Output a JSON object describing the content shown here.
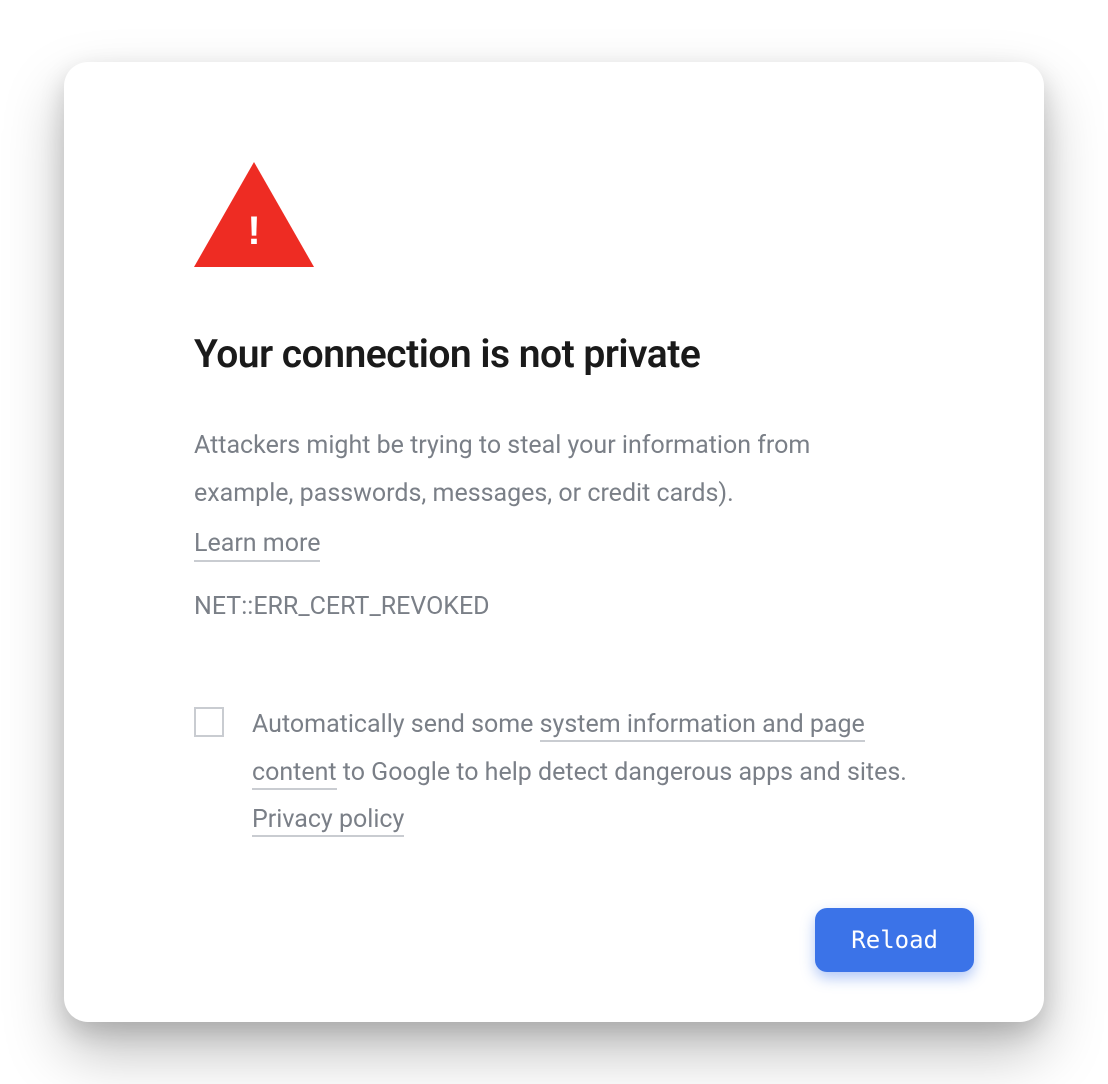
{
  "warning": {
    "title": "Your connection is not private",
    "body": "Attackers might be trying to steal your information from example, passwords, messages, or credit cards).",
    "learn_more": "Learn more",
    "error_code": "NET::ERR_CERT_REVOKED"
  },
  "report": {
    "prefix": "Automatically send some ",
    "link1": "system information and page content",
    "middle": " to Google to help detect dangerous apps and sites. ",
    "privacy": "Privacy policy"
  },
  "actions": {
    "reload": "Reload"
  },
  "colors": {
    "danger": "#ee2c23",
    "primary": "#3b73e8",
    "muted": "#7a7f87"
  }
}
